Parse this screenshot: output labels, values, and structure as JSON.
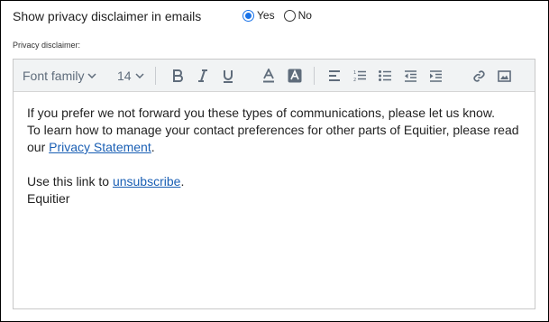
{
  "setting": {
    "label": "Show privacy disclaimer in emails",
    "options": [
      {
        "label": "Yes",
        "selected": true
      },
      {
        "label": "No",
        "selected": false
      }
    ]
  },
  "editor": {
    "label": "Privacy disclaimer:",
    "toolbar": {
      "font_family": "Font family",
      "font_size": "14"
    },
    "content": {
      "line1": "If you prefer we not forward you these types of communications, please let us know.",
      "line2": "To learn how to manage your contact preferences for other parts of Equitier, please read",
      "line3_prefix": "our ",
      "line3_link": "Privacy Statement",
      "line3_suffix": ".",
      "line4_prefix": "Use this link to ",
      "line4_link": "unsubscribe",
      "line4_suffix": ".",
      "line5": "Equitier"
    }
  },
  "colors": {
    "accent": "#1a73e8",
    "link": "#1a5fb4",
    "toolbar_bg": "#f1f3f4",
    "icon": "#5f6c7b"
  }
}
